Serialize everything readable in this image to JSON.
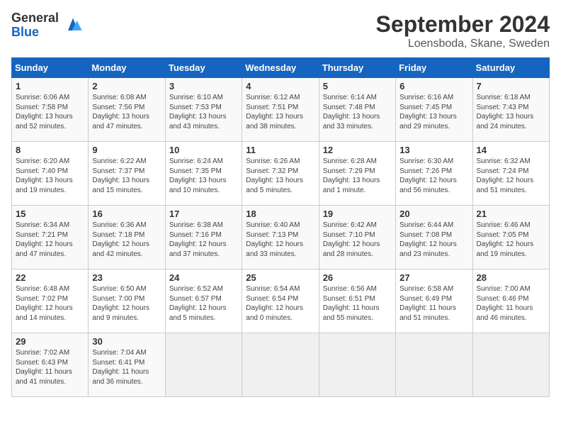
{
  "header": {
    "logo_general": "General",
    "logo_blue": "Blue",
    "month_title": "September 2024",
    "location": "Loensboda, Skane, Sweden"
  },
  "days_of_week": [
    "Sunday",
    "Monday",
    "Tuesday",
    "Wednesday",
    "Thursday",
    "Friday",
    "Saturday"
  ],
  "weeks": [
    [
      {
        "day": "1",
        "sunrise": "Sunrise: 6:06 AM",
        "sunset": "Sunset: 7:58 PM",
        "daylight": "Daylight: 13 hours and 52 minutes."
      },
      {
        "day": "2",
        "sunrise": "Sunrise: 6:08 AM",
        "sunset": "Sunset: 7:56 PM",
        "daylight": "Daylight: 13 hours and 47 minutes."
      },
      {
        "day": "3",
        "sunrise": "Sunrise: 6:10 AM",
        "sunset": "Sunset: 7:53 PM",
        "daylight": "Daylight: 13 hours and 43 minutes."
      },
      {
        "day": "4",
        "sunrise": "Sunrise: 6:12 AM",
        "sunset": "Sunset: 7:51 PM",
        "daylight": "Daylight: 13 hours and 38 minutes."
      },
      {
        "day": "5",
        "sunrise": "Sunrise: 6:14 AM",
        "sunset": "Sunset: 7:48 PM",
        "daylight": "Daylight: 13 hours and 33 minutes."
      },
      {
        "day": "6",
        "sunrise": "Sunrise: 6:16 AM",
        "sunset": "Sunset: 7:45 PM",
        "daylight": "Daylight: 13 hours and 29 minutes."
      },
      {
        "day": "7",
        "sunrise": "Sunrise: 6:18 AM",
        "sunset": "Sunset: 7:43 PM",
        "daylight": "Daylight: 13 hours and 24 minutes."
      }
    ],
    [
      {
        "day": "8",
        "sunrise": "Sunrise: 6:20 AM",
        "sunset": "Sunset: 7:40 PM",
        "daylight": "Daylight: 13 hours and 19 minutes."
      },
      {
        "day": "9",
        "sunrise": "Sunrise: 6:22 AM",
        "sunset": "Sunset: 7:37 PM",
        "daylight": "Daylight: 13 hours and 15 minutes."
      },
      {
        "day": "10",
        "sunrise": "Sunrise: 6:24 AM",
        "sunset": "Sunset: 7:35 PM",
        "daylight": "Daylight: 13 hours and 10 minutes."
      },
      {
        "day": "11",
        "sunrise": "Sunrise: 6:26 AM",
        "sunset": "Sunset: 7:32 PM",
        "daylight": "Daylight: 13 hours and 5 minutes."
      },
      {
        "day": "12",
        "sunrise": "Sunrise: 6:28 AM",
        "sunset": "Sunset: 7:29 PM",
        "daylight": "Daylight: 13 hours and 1 minute."
      },
      {
        "day": "13",
        "sunrise": "Sunrise: 6:30 AM",
        "sunset": "Sunset: 7:26 PM",
        "daylight": "Daylight: 12 hours and 56 minutes."
      },
      {
        "day": "14",
        "sunrise": "Sunrise: 6:32 AM",
        "sunset": "Sunset: 7:24 PM",
        "daylight": "Daylight: 12 hours and 51 minutes."
      }
    ],
    [
      {
        "day": "15",
        "sunrise": "Sunrise: 6:34 AM",
        "sunset": "Sunset: 7:21 PM",
        "daylight": "Daylight: 12 hours and 47 minutes."
      },
      {
        "day": "16",
        "sunrise": "Sunrise: 6:36 AM",
        "sunset": "Sunset: 7:18 PM",
        "daylight": "Daylight: 12 hours and 42 minutes."
      },
      {
        "day": "17",
        "sunrise": "Sunrise: 6:38 AM",
        "sunset": "Sunset: 7:16 PM",
        "daylight": "Daylight: 12 hours and 37 minutes."
      },
      {
        "day": "18",
        "sunrise": "Sunrise: 6:40 AM",
        "sunset": "Sunset: 7:13 PM",
        "daylight": "Daylight: 12 hours and 33 minutes."
      },
      {
        "day": "19",
        "sunrise": "Sunrise: 6:42 AM",
        "sunset": "Sunset: 7:10 PM",
        "daylight": "Daylight: 12 hours and 28 minutes."
      },
      {
        "day": "20",
        "sunrise": "Sunrise: 6:44 AM",
        "sunset": "Sunset: 7:08 PM",
        "daylight": "Daylight: 12 hours and 23 minutes."
      },
      {
        "day": "21",
        "sunrise": "Sunrise: 6:46 AM",
        "sunset": "Sunset: 7:05 PM",
        "daylight": "Daylight: 12 hours and 19 minutes."
      }
    ],
    [
      {
        "day": "22",
        "sunrise": "Sunrise: 6:48 AM",
        "sunset": "Sunset: 7:02 PM",
        "daylight": "Daylight: 12 hours and 14 minutes."
      },
      {
        "day": "23",
        "sunrise": "Sunrise: 6:50 AM",
        "sunset": "Sunset: 7:00 PM",
        "daylight": "Daylight: 12 hours and 9 minutes."
      },
      {
        "day": "24",
        "sunrise": "Sunrise: 6:52 AM",
        "sunset": "Sunset: 6:57 PM",
        "daylight": "Daylight: 12 hours and 5 minutes."
      },
      {
        "day": "25",
        "sunrise": "Sunrise: 6:54 AM",
        "sunset": "Sunset: 6:54 PM",
        "daylight": "Daylight: 12 hours and 0 minutes."
      },
      {
        "day": "26",
        "sunrise": "Sunrise: 6:56 AM",
        "sunset": "Sunset: 6:51 PM",
        "daylight": "Daylight: 11 hours and 55 minutes."
      },
      {
        "day": "27",
        "sunrise": "Sunrise: 6:58 AM",
        "sunset": "Sunset: 6:49 PM",
        "daylight": "Daylight: 11 hours and 51 minutes."
      },
      {
        "day": "28",
        "sunrise": "Sunrise: 7:00 AM",
        "sunset": "Sunset: 6:46 PM",
        "daylight": "Daylight: 11 hours and 46 minutes."
      }
    ],
    [
      {
        "day": "29",
        "sunrise": "Sunrise: 7:02 AM",
        "sunset": "Sunset: 6:43 PM",
        "daylight": "Daylight: 11 hours and 41 minutes."
      },
      {
        "day": "30",
        "sunrise": "Sunrise: 7:04 AM",
        "sunset": "Sunset: 6:41 PM",
        "daylight": "Daylight: 11 hours and 36 minutes."
      },
      null,
      null,
      null,
      null,
      null
    ]
  ]
}
